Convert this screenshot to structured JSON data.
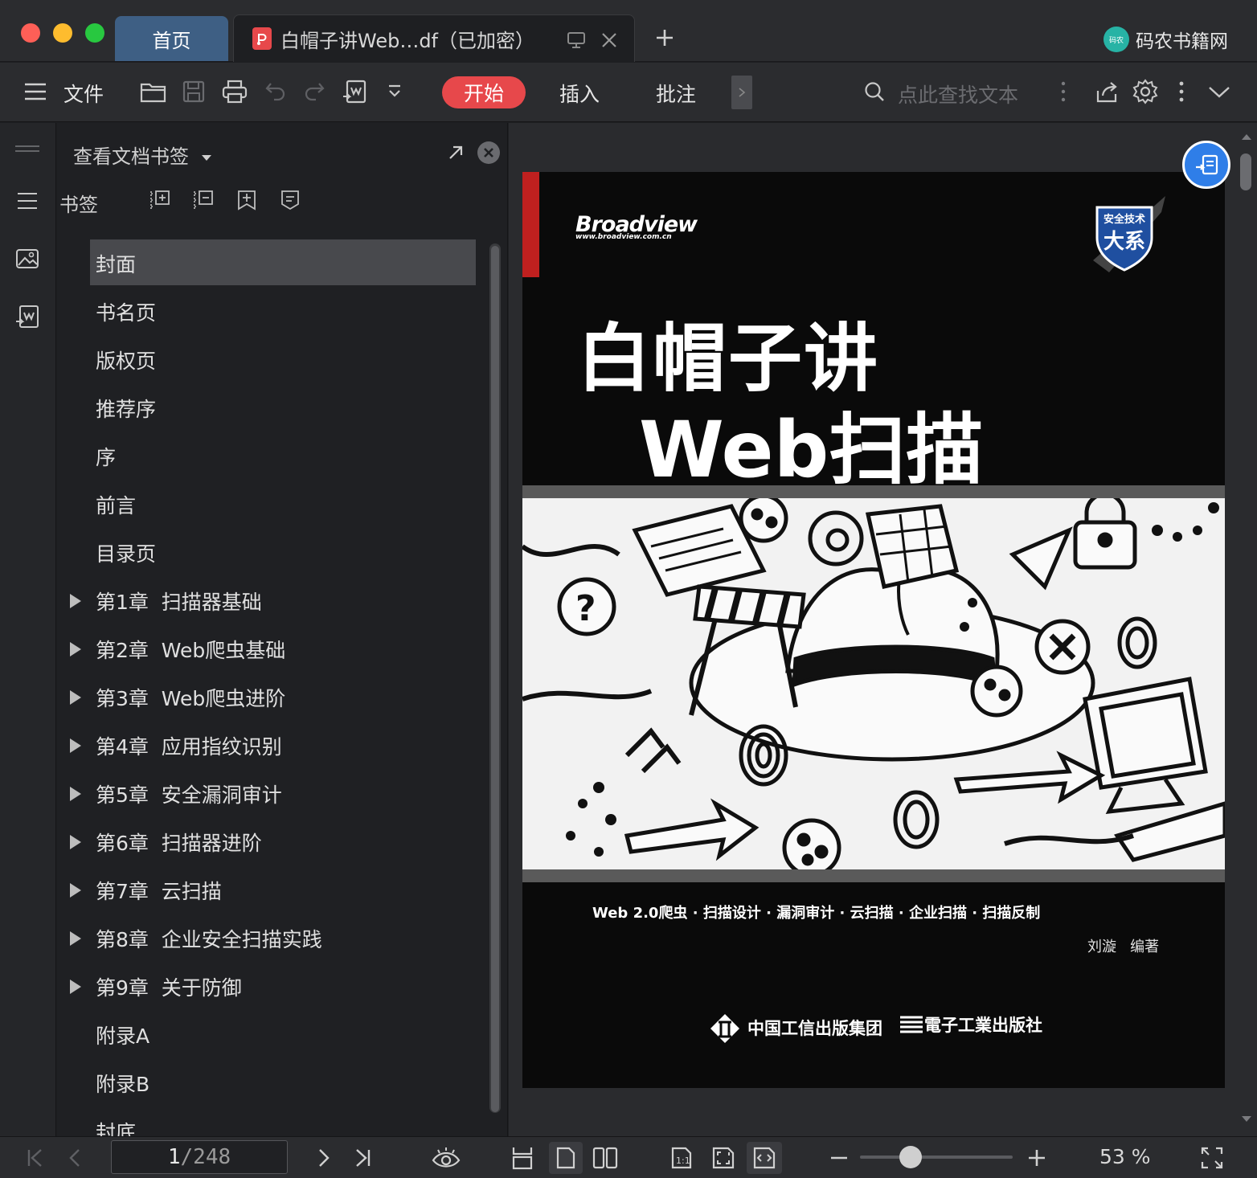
{
  "window": {
    "tabs": {
      "home": "首页",
      "document": "白帽子讲Web…df（已加密）"
    },
    "brand": "码农书籍网",
    "brand_badge": "码农"
  },
  "toolbar": {
    "file_label": "文件",
    "menu_start": "开始",
    "menu_insert": "插入",
    "menu_annotate": "批注",
    "search_placeholder": "点此查找文本",
    "accent_color": "#e7484b"
  },
  "bookmarks_panel": {
    "title": "查看文档书签",
    "section_label": "书签",
    "items": [
      {
        "label": "封面",
        "expandable": false,
        "selected": true
      },
      {
        "label": "书名页",
        "expandable": false
      },
      {
        "label": "版权页",
        "expandable": false
      },
      {
        "label": "推荐序",
        "expandable": false
      },
      {
        "label": "序",
        "expandable": false
      },
      {
        "label": "前言",
        "expandable": false
      },
      {
        "label": "目录页",
        "expandable": false
      },
      {
        "label": "第1章  扫描器基础",
        "expandable": true
      },
      {
        "label": "第2章  Web爬虫基础",
        "expandable": true
      },
      {
        "label": "第3章  Web爬虫进阶",
        "expandable": true
      },
      {
        "label": "第4章  应用指纹识别",
        "expandable": true
      },
      {
        "label": "第5章  安全漏洞审计",
        "expandable": true
      },
      {
        "label": "第6章  扫描器进阶",
        "expandable": true
      },
      {
        "label": "第7章  云扫描",
        "expandable": true
      },
      {
        "label": "第8章  企业安全扫描实践",
        "expandable": true
      },
      {
        "label": "第9章  关于防御",
        "expandable": true
      },
      {
        "label": "附录A",
        "expandable": false
      },
      {
        "label": "附录B",
        "expandable": false
      },
      {
        "label": "封底",
        "expandable": false
      }
    ]
  },
  "cover": {
    "publisher_brand": "Broadview",
    "publisher_url": "www.broadview.com.cn",
    "series_badge_line1": "安全技术",
    "series_badge_line2": "大系",
    "title_line1": "白帽子讲",
    "title_line2": "Web扫描",
    "subtitle": "Web 2.0爬虫 · 扫描设计 · 漏洞审计 · 云扫描 · 企业扫描 · 扫描反制",
    "author": "刘漩   编著",
    "publisher1": "中国工信出版集团",
    "publisher2": "電子工業出版社"
  },
  "status": {
    "current_page": "1",
    "page_total": "/248",
    "zoom": "53 %",
    "zoom_fraction": 0.33
  }
}
